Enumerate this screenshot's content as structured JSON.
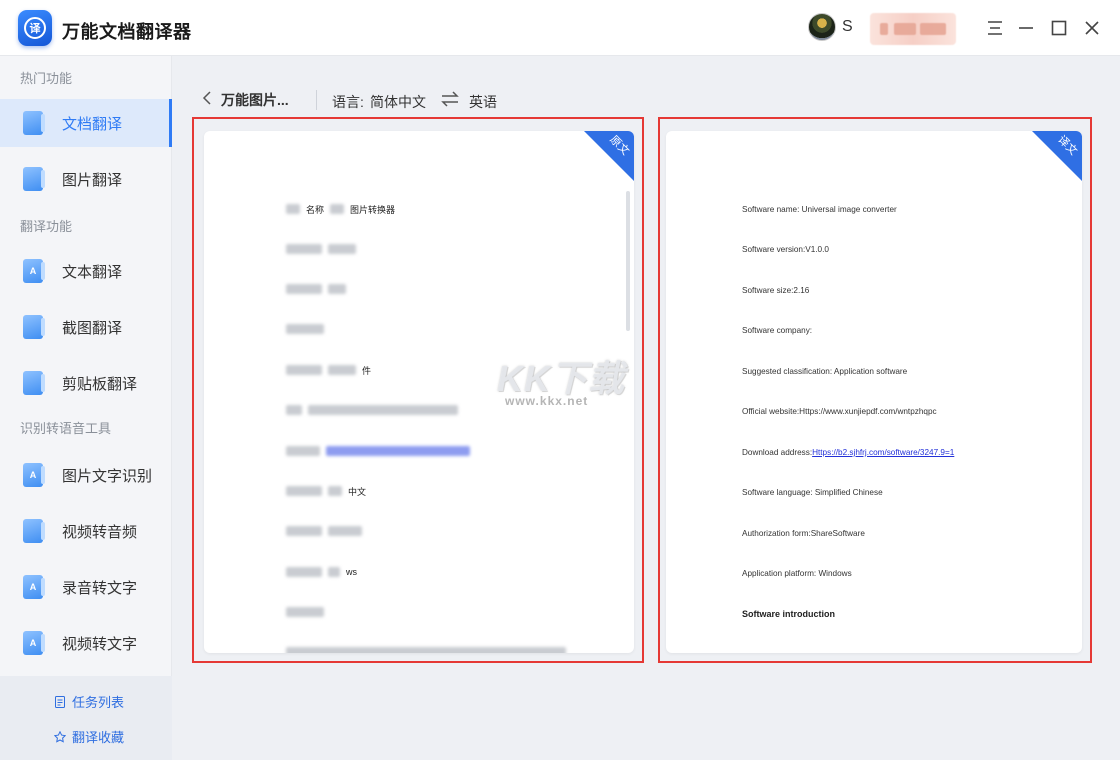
{
  "app": {
    "title": "万能文档翻译器",
    "logo_char": "译",
    "username": "S"
  },
  "sidebar": {
    "sections": [
      {
        "label": "热门功能",
        "items": [
          {
            "label": "文档翻译",
            "icon": "document-icon",
            "active": true
          },
          {
            "label": "图片翻译",
            "icon": "image-icon",
            "active": false
          }
        ]
      },
      {
        "label": "翻译功能",
        "items": [
          {
            "label": "文本翻译",
            "icon": "text-icon",
            "glyph": "A",
            "active": false
          },
          {
            "label": "截图翻译",
            "icon": "screenshot-icon",
            "active": false
          },
          {
            "label": "剪贴板翻译",
            "icon": "clipboard-icon",
            "active": false
          }
        ]
      },
      {
        "label": "识别转语音工具",
        "items": [
          {
            "label": "图片文字识别",
            "icon": "ocr-icon",
            "glyph": "A",
            "active": false
          },
          {
            "label": "视频转音频",
            "icon": "video-audio-icon",
            "active": false
          },
          {
            "label": "录音转文字",
            "icon": "voice-text-icon",
            "glyph": "A",
            "active": false
          },
          {
            "label": "视频转文字",
            "icon": "video-text-icon",
            "glyph": "A",
            "active": false
          }
        ]
      }
    ],
    "footer": {
      "task_list": "任务列表",
      "favorites": "翻译收藏"
    }
  },
  "toolbar": {
    "doc_name": "万能图片...",
    "lang_label": "语言:",
    "source_lang": "简体中文",
    "target_lang": "英语"
  },
  "original_panel": {
    "corner_label": "原文",
    "visible_fragments": [
      "名称",
      "图片转换器",
      "件",
      "中文",
      "ws"
    ]
  },
  "translated_panel": {
    "corner_label": "译文",
    "lines": [
      "Software name: Universal image converter",
      "Software version:V1.0.0",
      "Software size:2.16",
      "Software company:",
      "Suggested classification: Application software",
      "Official website:Https://www.xunjiepdf.com/wntpzhqpc",
      "Download address:",
      "Software language: Simplified Chinese",
      "Authorization form:ShareSoftware",
      "Application platform: Windows",
      "Software introduction"
    ],
    "download_link": "Https://b2.sjhfrj.com/software/3247.9=1"
  },
  "watermark": {
    "main": "KK下载",
    "site": "www.kkx.net"
  },
  "colors": {
    "accent": "#2f7bf5",
    "highlight_border": "#e53935",
    "corner": "#2f6fe4"
  }
}
